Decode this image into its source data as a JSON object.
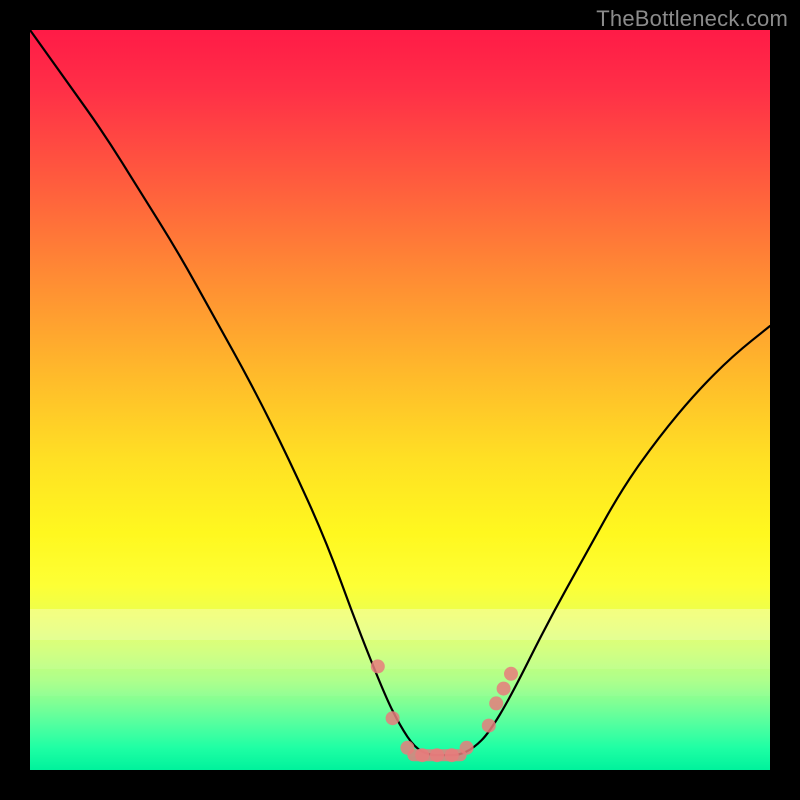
{
  "watermark": "TheBottleneck.com",
  "chart_data": {
    "type": "line",
    "title": "",
    "xlabel": "",
    "ylabel": "",
    "xlim": [
      0,
      100
    ],
    "ylim": [
      0,
      100
    ],
    "x": [
      0,
      5,
      10,
      15,
      20,
      25,
      30,
      35,
      40,
      44,
      48,
      50,
      52,
      54,
      56,
      58,
      60,
      62,
      65,
      70,
      75,
      80,
      85,
      90,
      95,
      100
    ],
    "values": [
      100,
      93,
      86,
      78,
      70,
      61,
      52,
      42,
      31,
      20,
      10,
      6,
      3,
      2,
      2,
      2,
      3,
      5,
      10,
      20,
      29,
      38,
      45,
      51,
      56,
      60
    ],
    "annotation": "V-shaped bottleneck curve with minimum plateau around x≈52–58. Background is a vertical heatmap gradient red→yellow→green with lighter horizontal bands near y≈20 and y≈14.",
    "markers": [
      {
        "x": 47,
        "y": 14
      },
      {
        "x": 49,
        "y": 7
      },
      {
        "x": 51,
        "y": 3
      },
      {
        "x": 53,
        "y": 2
      },
      {
        "x": 55,
        "y": 2
      },
      {
        "x": 57,
        "y": 2
      },
      {
        "x": 59,
        "y": 3
      },
      {
        "x": 62,
        "y": 6
      },
      {
        "x": 63,
        "y": 9
      },
      {
        "x": 64,
        "y": 11
      },
      {
        "x": 65,
        "y": 13
      }
    ],
    "bands_y": [
      20,
      16,
      12
    ],
    "gradient_stops": [
      {
        "pos": 0,
        "color": "#ff1b47"
      },
      {
        "pos": 25,
        "color": "#ff7a37"
      },
      {
        "pos": 50,
        "color": "#ffd326"
      },
      {
        "pos": 70,
        "color": "#fff81f"
      },
      {
        "pos": 90,
        "color": "#7fff95"
      },
      {
        "pos": 100,
        "color": "#00f29c"
      }
    ]
  }
}
